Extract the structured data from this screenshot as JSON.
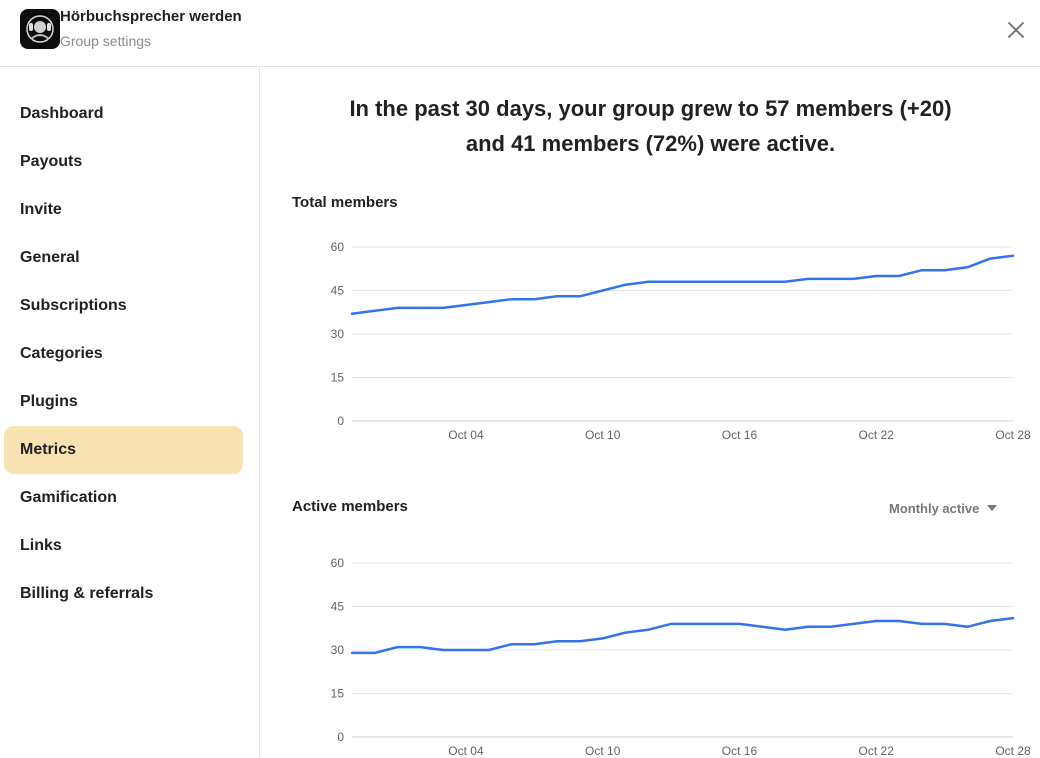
{
  "header": {
    "group_name": "Hörbuchsprecher werden",
    "subtitle": "Group settings"
  },
  "sidebar": {
    "items": [
      {
        "label": "Dashboard",
        "active": false
      },
      {
        "label": "Payouts",
        "active": false
      },
      {
        "label": "Invite",
        "active": false
      },
      {
        "label": "General",
        "active": false
      },
      {
        "label": "Subscriptions",
        "active": false
      },
      {
        "label": "Categories",
        "active": false
      },
      {
        "label": "Plugins",
        "active": false
      },
      {
        "label": "Metrics",
        "active": true
      },
      {
        "label": "Gamification",
        "active": false
      },
      {
        "label": "Links",
        "active": false
      },
      {
        "label": "Billing & referrals",
        "active": false
      }
    ]
  },
  "main": {
    "headline_line1": "In the past 30 days, your group grew to 57 members (+20)",
    "headline_line2": "and 41 members (72%) were active.",
    "dropdown_label": "Monthly active"
  },
  "colors": {
    "line": "#3574e8",
    "active_nav": "#f8e2b2",
    "grid": "#e6e6e6"
  },
  "chart_data": [
    {
      "type": "line",
      "title": "Total members",
      "ylim": [
        0,
        60
      ],
      "yticks": [
        0,
        15,
        30,
        45,
        60
      ],
      "xticks": [
        "Oct 04",
        "Oct 10",
        "Oct 16",
        "Oct 22",
        "Oct 28"
      ],
      "xtick_days": [
        4,
        10,
        16,
        22,
        28
      ],
      "x": [
        29,
        30,
        1,
        2,
        3,
        4,
        5,
        6,
        7,
        8,
        9,
        10,
        11,
        12,
        13,
        14,
        15,
        16,
        17,
        18,
        19,
        20,
        21,
        22,
        23,
        24,
        25,
        26,
        27,
        28,
        29
      ],
      "day_index": [
        0,
        1,
        2,
        3,
        4,
        5,
        6,
        7,
        8,
        9,
        10,
        11,
        12,
        13,
        14,
        15,
        16,
        17,
        18,
        19,
        20,
        21,
        22,
        23,
        24,
        25,
        26,
        27,
        28,
        29,
        30
      ],
      "values": [
        37,
        38,
        39,
        39,
        39,
        40,
        41,
        42,
        42,
        43,
        43,
        45,
        47,
        48,
        48,
        48,
        48,
        48,
        48,
        48,
        49,
        49,
        49,
        50,
        50,
        52,
        52,
        53,
        56,
        57
      ],
      "grid": true
    },
    {
      "type": "line",
      "title": "Active members",
      "ylim": [
        0,
        60
      ],
      "yticks": [
        0,
        15,
        30,
        45,
        60
      ],
      "xticks": [
        "Oct 04",
        "Oct 10",
        "Oct 16",
        "Oct 22",
        "Oct 28"
      ],
      "xtick_days": [
        4,
        10,
        16,
        22,
        28
      ],
      "values": [
        29,
        29,
        31,
        31,
        30,
        30,
        30,
        32,
        32,
        33,
        33,
        34,
        36,
        37,
        39,
        39,
        39,
        39,
        38,
        37,
        38,
        38,
        39,
        40,
        40,
        39,
        39,
        38,
        40,
        41
      ],
      "grid": true
    }
  ]
}
